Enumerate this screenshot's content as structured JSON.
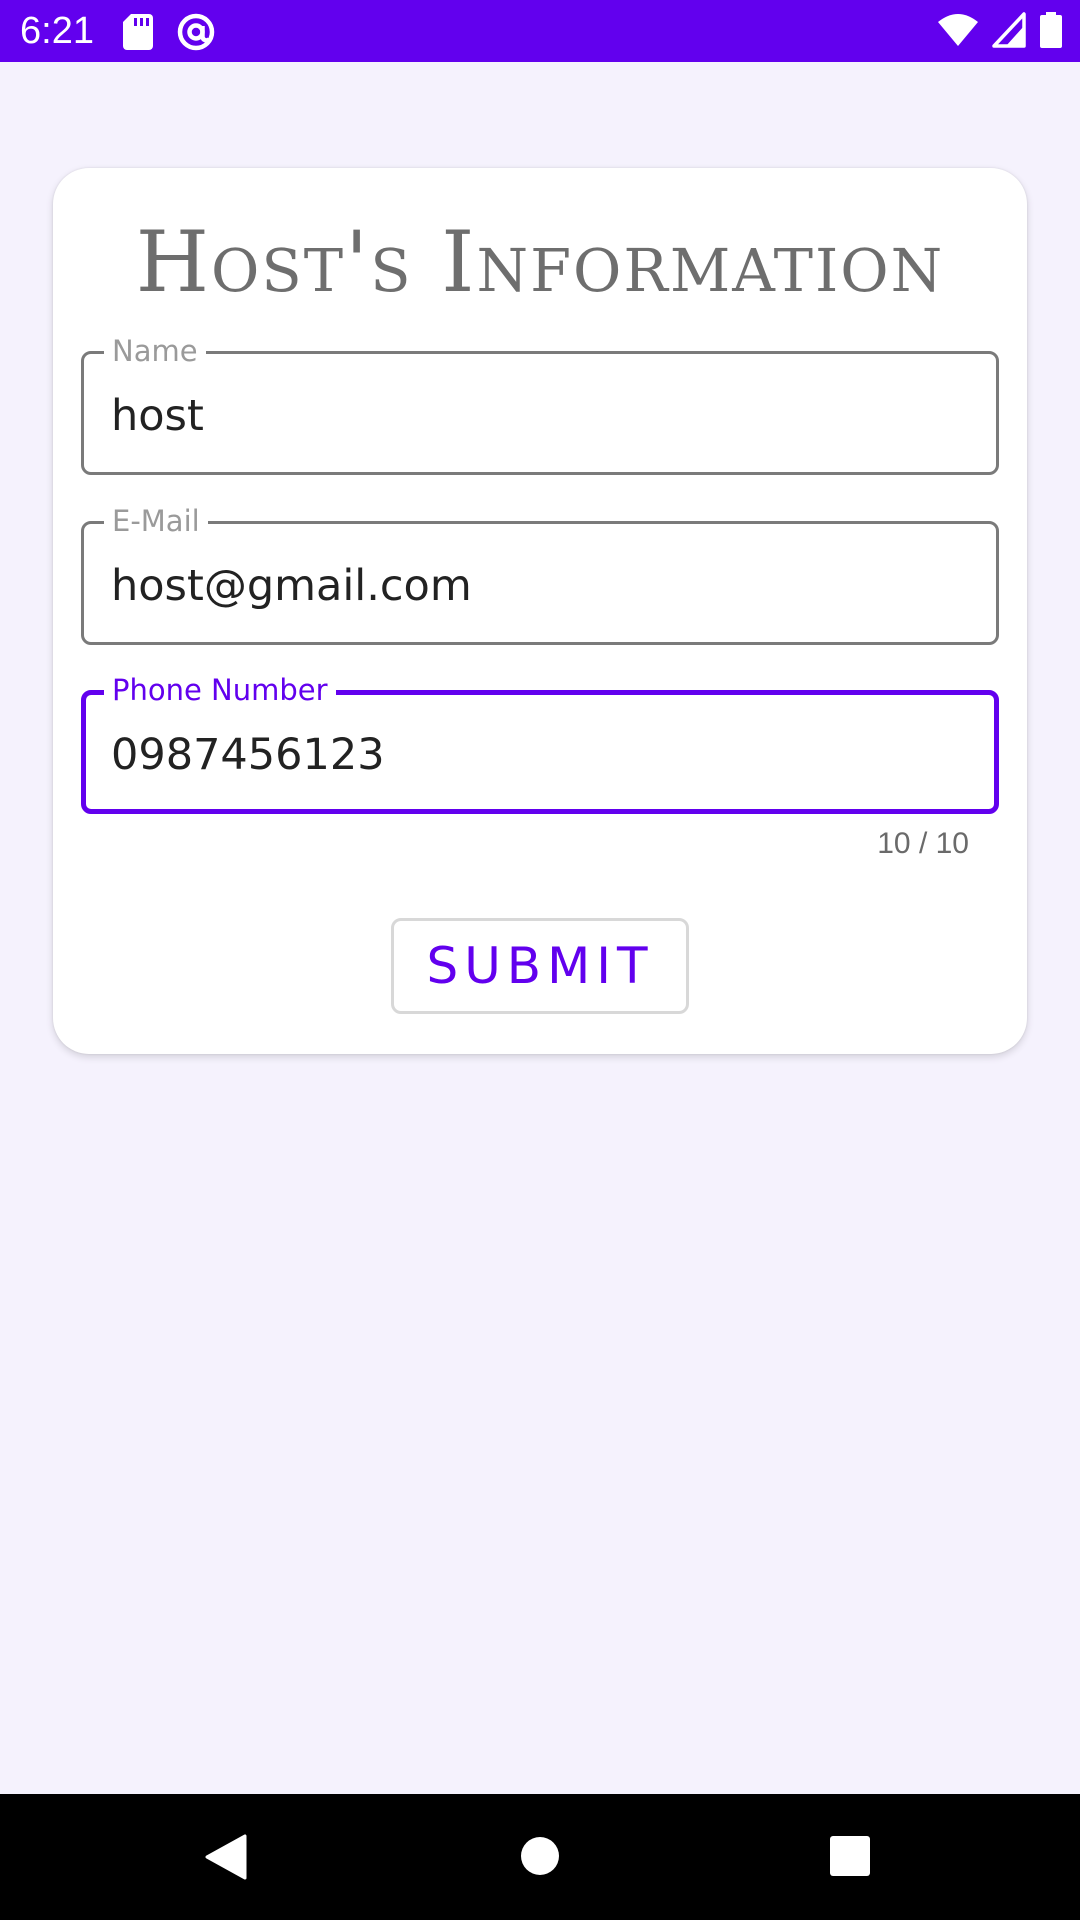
{
  "status_bar": {
    "time": "6:21",
    "background_color": "#6200ee",
    "left_icons": [
      "sd-card-icon",
      "at-sign-notification-icon"
    ],
    "right_icons": [
      "wifi-icon",
      "cell-signal-icon",
      "battery-icon"
    ]
  },
  "card": {
    "title": "Host's Information",
    "fields": [
      {
        "label": "Name",
        "value": "host",
        "focused": false
      },
      {
        "label": "E-Mail",
        "value": "host@gmail.com",
        "focused": false
      },
      {
        "label": "Phone Number",
        "value": "0987456123",
        "focused": true
      }
    ],
    "phone_counter": "10 / 10",
    "submit_label": "SUBMIT"
  },
  "colors": {
    "accent": "#6200ee",
    "background": "#f5f2fd",
    "title": "#6e6e6e"
  },
  "nav_bar": {
    "buttons": [
      "back-icon",
      "home-icon",
      "recents-icon"
    ]
  }
}
